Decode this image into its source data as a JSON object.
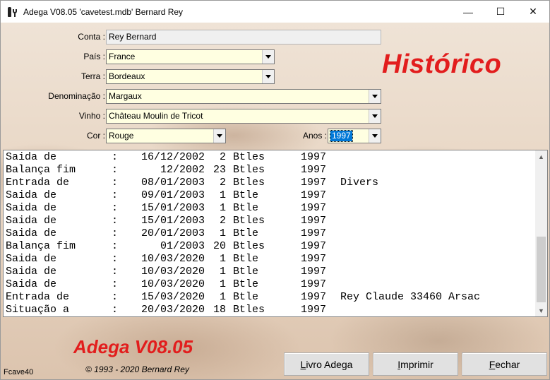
{
  "window": {
    "title": "Adega V08.05  'cavetest.mdb'  Bernard Rey",
    "minimize": "—",
    "maximize": "☐",
    "close": "✕"
  },
  "form": {
    "conta_label": "Conta :",
    "conta_value": "Rey Bernard",
    "pais_label": "País :",
    "pais_value": "France",
    "terra_label": "Terra :",
    "terra_value": "Bordeaux",
    "denominacao_label": "Denominação :",
    "denominacao_value": "Margaux",
    "vinho_label": "Vinho :",
    "vinho_value": "Château Moulin de Tricot",
    "cor_label": "Cor :",
    "cor_value": "Rouge",
    "anos_label": "Anos :",
    "anos_value": "1997"
  },
  "heading": "Histórico",
  "history": [
    {
      "kind": "Saida de",
      "sep": ":",
      "date": "16/12/2002",
      "qty": "2",
      "unit": "Btles",
      "year": "1997",
      "note": ""
    },
    {
      "kind": "Balança fim",
      "sep": ":",
      "date": "12/2002",
      "qty": "23",
      "unit": "Btles",
      "year": "1997",
      "note": ""
    },
    {
      "kind": "Entrada de",
      "sep": ":",
      "date": "08/01/2003",
      "qty": "2",
      "unit": "Btles",
      "year": "1997",
      "note": "Divers"
    },
    {
      "kind": "Saida de",
      "sep": ":",
      "date": "09/01/2003",
      "qty": "1",
      "unit": "Btle",
      "year": "1997",
      "note": ""
    },
    {
      "kind": "Saida de",
      "sep": ":",
      "date": "15/01/2003",
      "qty": "1",
      "unit": "Btle",
      "year": "1997",
      "note": ""
    },
    {
      "kind": "Saida de",
      "sep": ":",
      "date": "15/01/2003",
      "qty": "2",
      "unit": "Btles",
      "year": "1997",
      "note": ""
    },
    {
      "kind": "Saida de",
      "sep": ":",
      "date": "20/01/2003",
      "qty": "1",
      "unit": "Btle",
      "year": "1997",
      "note": ""
    },
    {
      "kind": "Balança fim",
      "sep": ":",
      "date": "01/2003",
      "qty": "20",
      "unit": "Btles",
      "year": "1997",
      "note": ""
    },
    {
      "kind": "Saida de",
      "sep": ":",
      "date": "10/03/2020",
      "qty": "1",
      "unit": "Btle",
      "year": "1997",
      "note": ""
    },
    {
      "kind": "Saida de",
      "sep": ":",
      "date": "10/03/2020",
      "qty": "1",
      "unit": "Btle",
      "year": "1997",
      "note": ""
    },
    {
      "kind": "Saida de",
      "sep": ":",
      "date": "10/03/2020",
      "qty": "1",
      "unit": "Btle",
      "year": "1997",
      "note": ""
    },
    {
      "kind": "Entrada de",
      "sep": ":",
      "date": "15/03/2020",
      "qty": "1",
      "unit": "Btle",
      "year": "1997",
      "note": "Rey Claude 33460 Arsac"
    },
    {
      "kind": "Situação a",
      "sep": ":",
      "date": "20/03/2020",
      "qty": "18",
      "unit": "Btles",
      "year": "1997",
      "note": ""
    }
  ],
  "footer": {
    "brand": "Adega V08.05",
    "copyright": "© 1993 - 2020 Bernard Rey",
    "form_id": "Fcave40",
    "livro_first": "L",
    "livro_rest": "ivro Adega",
    "imprimir_first": "I",
    "imprimir_rest": "mprimir",
    "fechar_first": "F",
    "fechar_rest": "echar"
  },
  "colors": {
    "accent_red": "#e21d1d",
    "field_bg": "#ffffe1",
    "selection": "#0078d7"
  }
}
